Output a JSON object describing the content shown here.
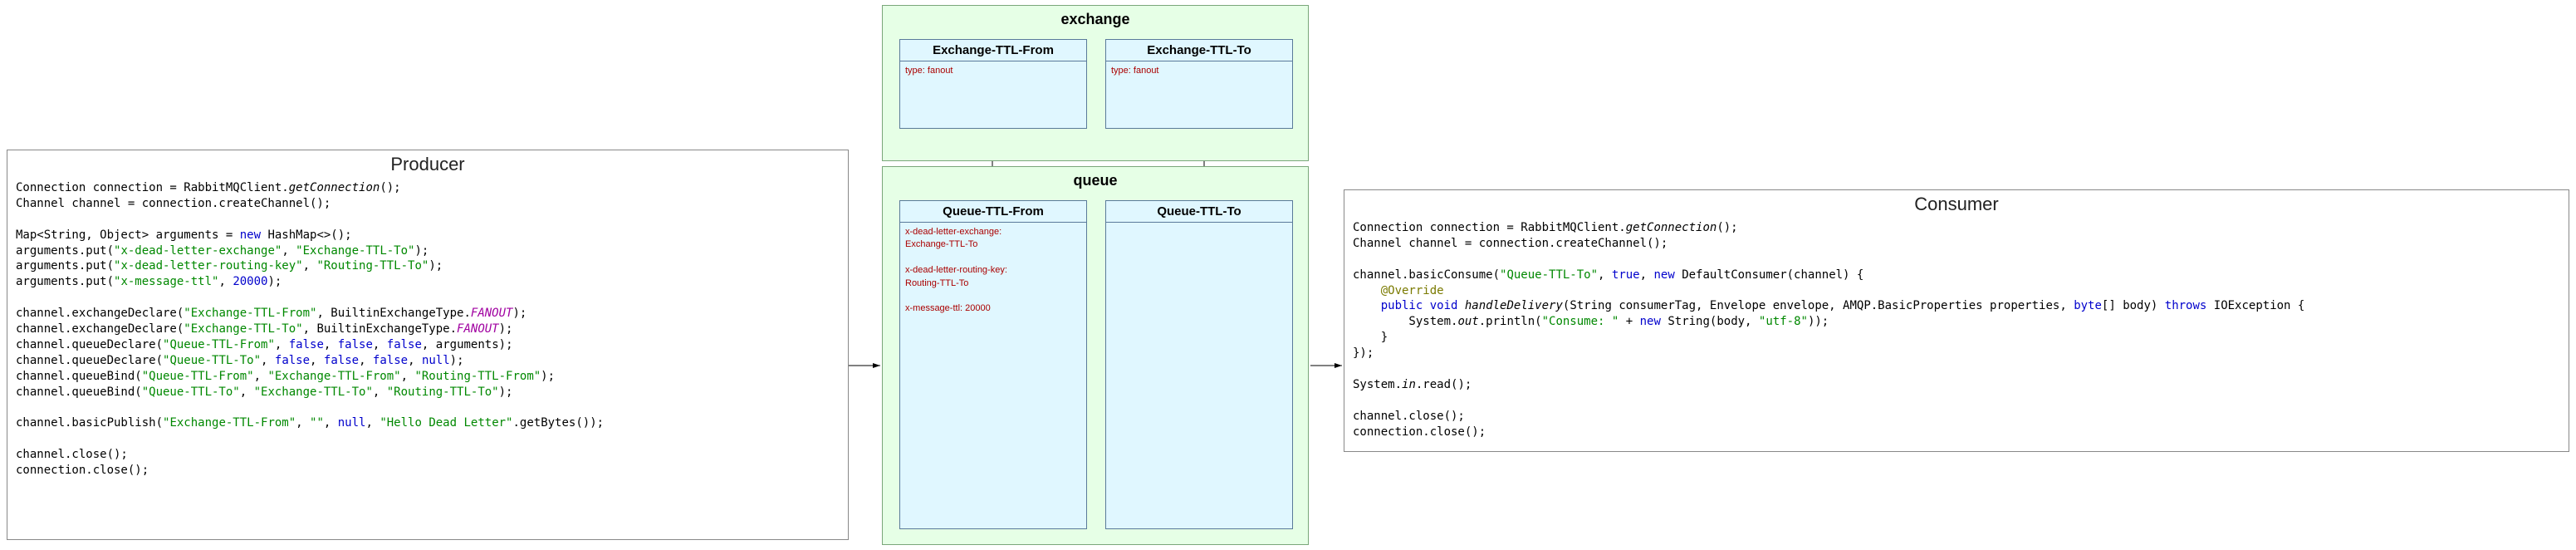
{
  "producer": {
    "title": "Producer",
    "code_html": "Connection connection = RabbitMQClient.<span class=\"c-it\">getConnection</span>();\nChannel channel = connection.createChannel();\n\nMap&lt;String, Object&gt; arguments = <span class=\"c-kw\">new</span> HashMap&lt;&gt;();\narguments.put(<span class=\"c-str\">\"x-dead-letter-exchange\"</span>, <span class=\"c-str\">\"Exchange-TTL-To\"</span>);\narguments.put(<span class=\"c-str\">\"x-dead-letter-routing-key\"</span>, <span class=\"c-str\">\"Routing-TTL-To\"</span>);\narguments.put(<span class=\"c-str\">\"x-message-ttl\"</span>, <span class=\"c-num\">20000</span>);\n\nchannel.exchangeDeclare(<span class=\"c-str\">\"Exchange-TTL-From\"</span>, BuiltinExchangeType.<span class=\"c-pur\">FANOUT</span>);\nchannel.exchangeDeclare(<span class=\"c-str\">\"Exchange-TTL-To\"</span>, BuiltinExchangeType.<span class=\"c-pur\">FANOUT</span>);\nchannel.queueDeclare(<span class=\"c-str\">\"Queue-TTL-From\"</span>, <span class=\"c-kw\">false</span>, <span class=\"c-kw\">false</span>, <span class=\"c-kw\">false</span>, arguments);\nchannel.queueDeclare(<span class=\"c-str\">\"Queue-TTL-To\"</span>, <span class=\"c-kw\">false</span>, <span class=\"c-kw\">false</span>, <span class=\"c-kw\">false</span>, <span class=\"c-kw\">null</span>);\nchannel.queueBind(<span class=\"c-str\">\"Queue-TTL-From\"</span>, <span class=\"c-str\">\"Exchange-TTL-From\"</span>, <span class=\"c-str\">\"Routing-TTL-From\"</span>);\nchannel.queueBind(<span class=\"c-str\">\"Queue-TTL-To\"</span>, <span class=\"c-str\">\"Exchange-TTL-To\"</span>, <span class=\"c-str\">\"Routing-TTL-To\"</span>);\n\nchannel.basicPublish(<span class=\"c-str\">\"Exchange-TTL-From\"</span>, <span class=\"c-str\">\"\"</span>, <span class=\"c-kw\">null</span>, <span class=\"c-str\">\"Hello Dead Letter\"</span>.getBytes());\n\nchannel.close();\nconnection.close();"
  },
  "consumer": {
    "title": "Consumer",
    "code_html": "Connection connection = RabbitMQClient.<span class=\"c-it\">getConnection</span>();\nChannel channel = connection.createChannel();\n\nchannel.basicConsume(<span class=\"c-str\">\"Queue-TTL-To\"</span>, <span class=\"c-kw\">true</span>, <span class=\"c-kw\">new</span> DefaultConsumer(channel) {\n    <span class=\"c-ann\">@Override</span>\n    <span class=\"c-kw\">public void</span> <span class=\"c-it\">handleDelivery</span>(String consumerTag, Envelope envelope, AMQP.BasicProperties properties, <span class=\"c-kw\">byte</span>[] body) <span class=\"c-kw\">throws</span> IOException {\n        System.<span class=\"c-it\">out</span>.println(<span class=\"c-str\">\"Consume: \"</span> + <span class=\"c-kw\">new</span> String(body, <span class=\"c-str\">\"utf-8\"</span>));\n    }\n});\n\nSystem.<span class=\"c-it\">in</span>.read();\n\nchannel.close();\nconnection.close();"
  },
  "exchange_group": {
    "title": "exchange"
  },
  "queue_group": {
    "title": "queue"
  },
  "exchange_from": {
    "title": "Exchange-TTL-From",
    "body": "type: fanout"
  },
  "exchange_to": {
    "title": "Exchange-TTL-To",
    "body": "type: fanout"
  },
  "queue_from": {
    "title": "Queue-TTL-From",
    "body_html": "x-dead-letter-exchange:<br>Exchange-TTL-To<br><br>x-dead-letter-routing-key:<br>Routing-TTL-To<br><br>x-message-ttl: 20000"
  },
  "queue_to": {
    "title": "Queue-TTL-To",
    "body_html": ""
  }
}
